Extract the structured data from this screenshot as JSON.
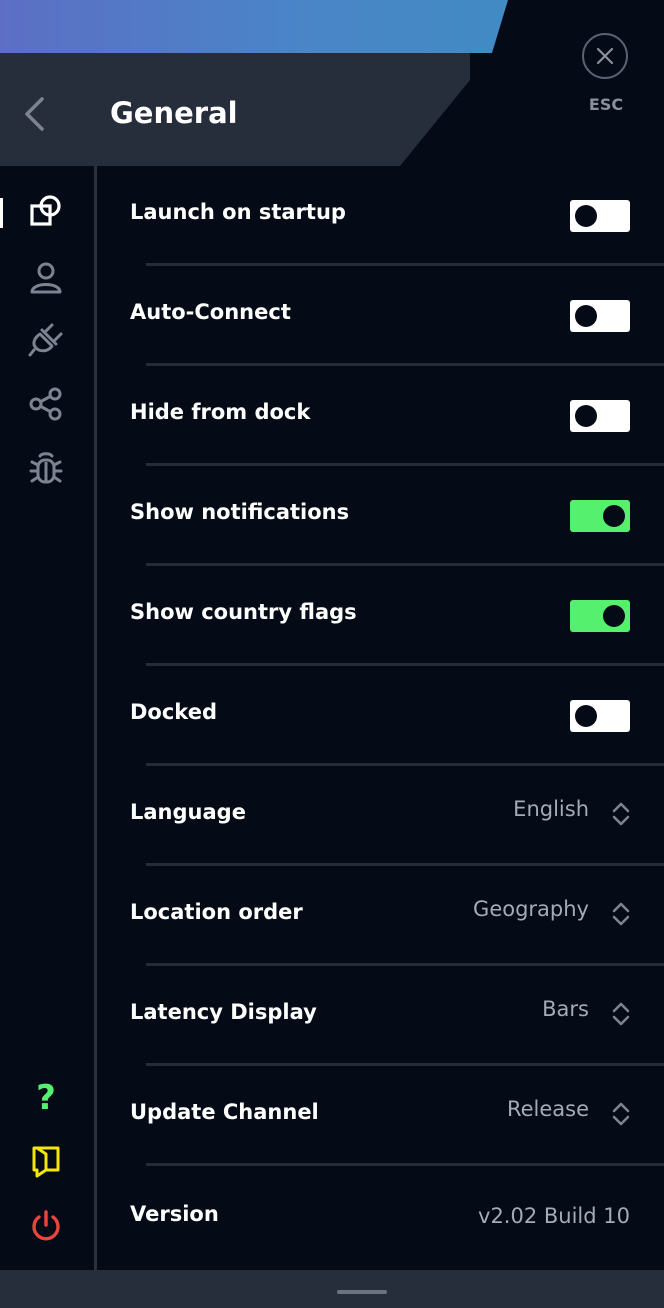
{
  "header": {
    "title": "General",
    "esc_label": "ESC"
  },
  "sidebar": {
    "items": [
      {
        "icon": "shapes-icon",
        "active": true
      },
      {
        "icon": "user-icon"
      },
      {
        "icon": "plug-icon"
      },
      {
        "icon": "share-icon"
      },
      {
        "icon": "bug-icon"
      }
    ],
    "bottom": [
      {
        "icon": "help-icon",
        "glyph": "?",
        "color": "#55f06d"
      },
      {
        "icon": "book-icon",
        "color": "#f5e50a"
      },
      {
        "icon": "power-icon",
        "color": "#e8453c"
      }
    ]
  },
  "settings": {
    "launch_on_startup": {
      "label": "Launch on startup",
      "on": false
    },
    "auto_connect": {
      "label": "Auto-Connect",
      "on": false
    },
    "hide_from_dock": {
      "label": "Hide from dock",
      "on": false
    },
    "show_notifications": {
      "label": "Show notifications",
      "on": true
    },
    "show_country_flags": {
      "label": "Show country flags",
      "on": true
    },
    "docked": {
      "label": "Docked",
      "on": false
    },
    "language": {
      "label": "Language",
      "value": "English"
    },
    "location_order": {
      "label": "Location order",
      "value": "Geography"
    },
    "latency_display": {
      "label": "Latency Display",
      "value": "Bars"
    },
    "update_channel": {
      "label": "Update Channel",
      "value": "Release"
    },
    "version": {
      "label": "Version",
      "value": "v2.02 Build 10"
    }
  },
  "colors": {
    "toggle_on": "#55f06d",
    "toggle_off": "#ffffff",
    "background": "#040b17",
    "panel": "#262d3b"
  }
}
